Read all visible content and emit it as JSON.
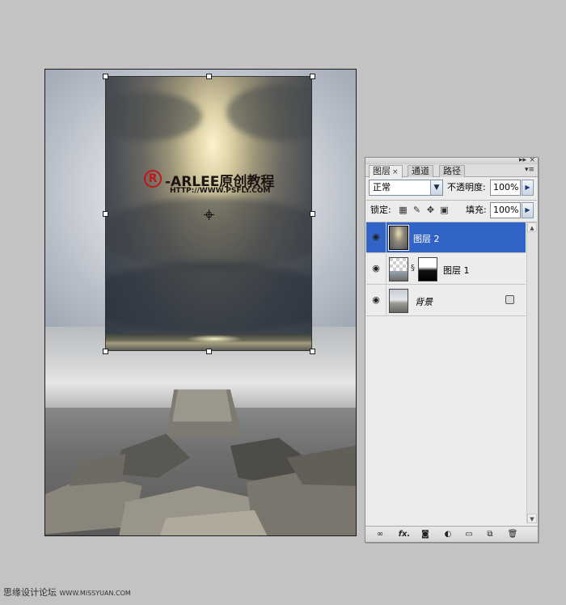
{
  "canvas": {
    "watermark_symbol": "R",
    "watermark_title": "-ARLEE原创教程",
    "watermark_url": "HTTP://WWW.PSFLY.COM"
  },
  "panel": {
    "tabs": [
      {
        "label": "图层",
        "active": true,
        "close": "×"
      },
      {
        "label": "通道",
        "active": false
      },
      {
        "label": "路径",
        "active": false
      }
    ],
    "blend_mode": "正常",
    "opacity_label": "不透明度:",
    "opacity_value": "100%",
    "lock_label": "锁定:",
    "fill_label": "填充:",
    "fill_value": "100%",
    "layers": [
      {
        "name": "图层 2",
        "selected": true,
        "visible": true
      },
      {
        "name": "图层 1",
        "selected": false,
        "visible": true,
        "has_mask": true
      },
      {
        "name": "背景",
        "selected": false,
        "visible": true,
        "locked": true
      }
    ],
    "bottom_icons": [
      "link-icon",
      "fx-icon",
      "mask-icon",
      "adjustment-icon",
      "folder-icon",
      "new-layer-icon",
      "trash-icon"
    ],
    "fx_label": "fx."
  },
  "footer": {
    "site_cn": "思缘设计论坛",
    "site_url": "WWW.MISSYUAN.COM"
  },
  "colors": {
    "selection": "#3264c8",
    "panel_bg": "#ececec",
    "workspace": "#c3c3c3",
    "watermark_red": "#c01818"
  }
}
